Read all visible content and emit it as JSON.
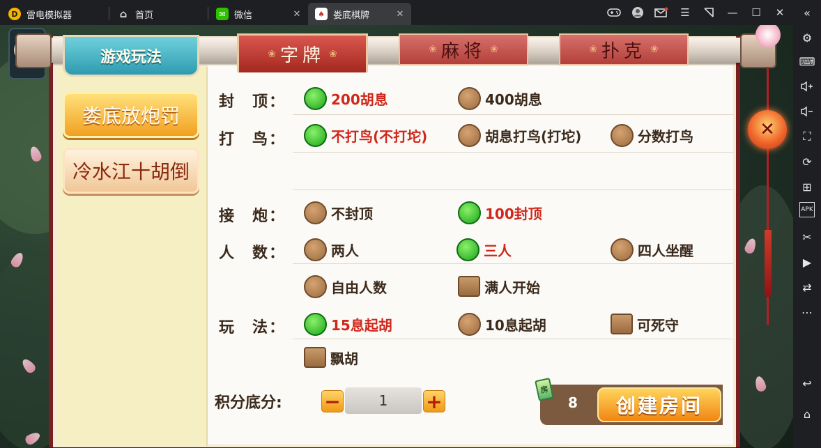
{
  "window": {
    "app_tab": {
      "label": "雷电模拟器"
    },
    "tabs": [
      {
        "label": "首页",
        "icon": "home-icon"
      },
      {
        "label": "微信",
        "icon": "wechat-icon"
      },
      {
        "label": "娄底棋牌",
        "icon": "app-icon"
      }
    ],
    "controls": [
      "gamepad-icon",
      "user-icon",
      "mail-icon",
      "menu-icon",
      "popout-icon",
      "minimize-icon",
      "maximize-icon",
      "close-icon",
      "collapse-icon"
    ]
  },
  "sidebar": {
    "icons": [
      "settings-icon",
      "keyboard-icon",
      "volume-up-icon",
      "volume-down-icon",
      "fullscreen-icon",
      "rotate-icon",
      "add-app-icon",
      "apk-icon",
      "scissors-icon",
      "video-icon",
      "sync-icon",
      "more-icon",
      "back-icon",
      "home-icon"
    ],
    "apk_label": "APK"
  },
  "game": {
    "rules_tab": "游戏玩法",
    "categories": [
      {
        "label": "字牌",
        "active": true
      },
      {
        "label": "麻将",
        "active": false
      },
      {
        "label": "扑克",
        "active": false
      }
    ],
    "rules": [
      {
        "label": "娄底放炮罚",
        "active": true
      },
      {
        "label": "冷水江十胡倒",
        "active": false
      }
    ],
    "rows": {
      "fengding": {
        "label": "封　顶：",
        "options": [
          "200胡息",
          "400胡息"
        ]
      },
      "daniao": {
        "label": "打　鸟：",
        "options": [
          "不打鸟(不打坨)",
          "胡息打鸟(打坨)",
          "分数打鸟"
        ]
      },
      "jiepao": {
        "label": "接　炮：",
        "options": [
          "不封顶",
          "100封顶"
        ]
      },
      "renshu": {
        "label": "人　数：",
        "options": [
          "两人",
          "三人",
          "四人坐醒",
          "自由人数",
          "满人开始"
        ]
      },
      "wanfa": {
        "label": "玩　法：",
        "options": [
          "15息起胡",
          "10息起胡",
          "可死守",
          "飘胡"
        ]
      }
    },
    "score": {
      "label": "积分底分:",
      "value": "1",
      "minus": "−",
      "plus": "+"
    },
    "create": {
      "cost": "8",
      "card_label": "房",
      "button": "创建房间"
    },
    "close_symbol": "✕"
  }
}
